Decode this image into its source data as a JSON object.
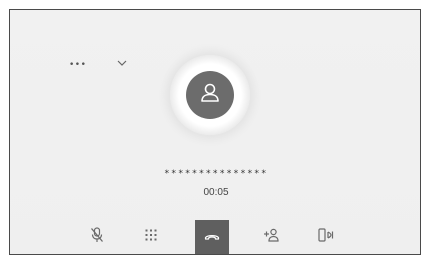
{
  "device": {
    "label": "•••",
    "chevron_icon": "chevron-down-icon"
  },
  "contact": {
    "avatar_icon": "person-icon",
    "number": "***************",
    "duration": "00:05"
  },
  "toolbar": {
    "buttons": [
      {
        "name": "mute",
        "icon": "microphone-muted-icon"
      },
      {
        "name": "keypad",
        "icon": "dialpad-icon"
      },
      {
        "name": "end-call",
        "icon": "hang-up-icon"
      },
      {
        "name": "add-participant",
        "icon": "add-person-icon"
      },
      {
        "name": "transfer",
        "icon": "phone-transfer-icon"
      }
    ]
  },
  "colors": {
    "background": "#efefef",
    "avatar": "#6c6c6c",
    "end_call": "#5f5f5f",
    "icon": "#6a6a6a"
  }
}
